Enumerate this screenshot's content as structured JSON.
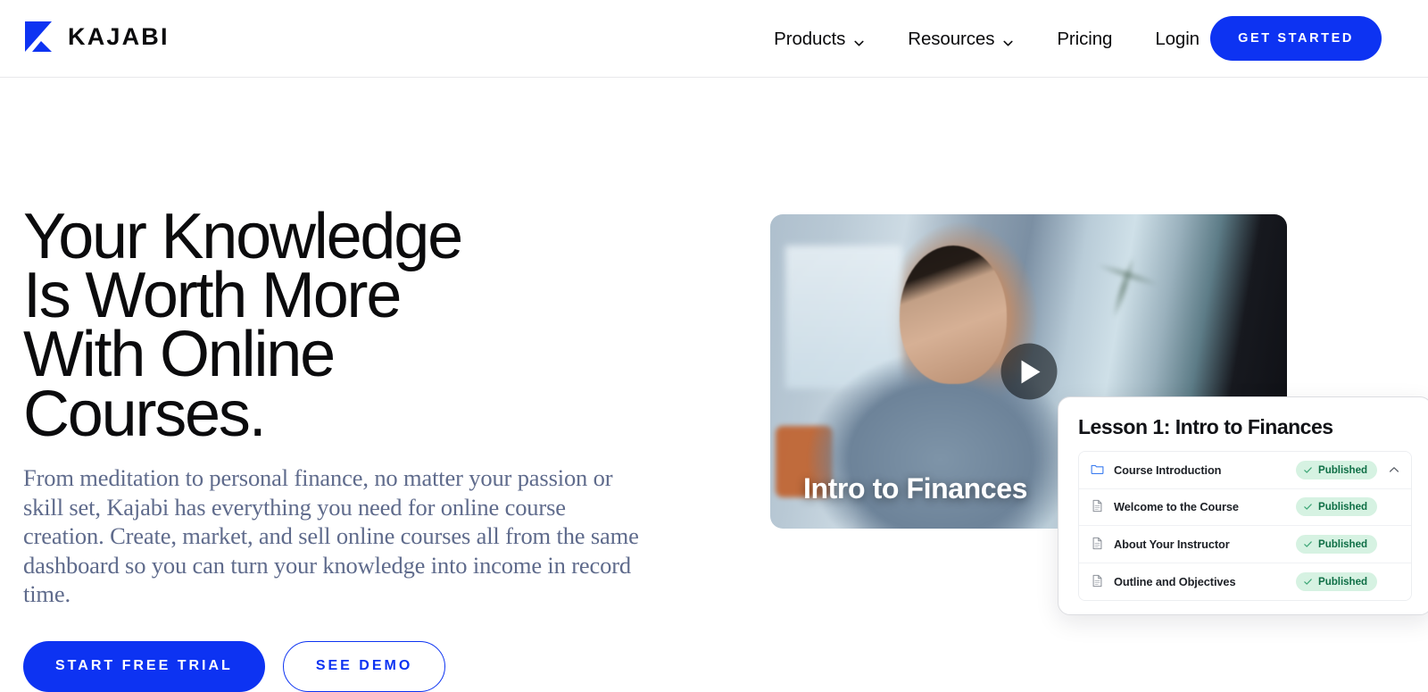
{
  "brand": {
    "name": "KAJABI",
    "logo_icon": "kajabi-k-logo",
    "accent_color": "#0d33f2",
    "text_color": "#0b0b0d"
  },
  "header": {
    "nav": [
      {
        "label": "Products",
        "icon": "chevron-down-icon",
        "has_dropdown": true
      },
      {
        "label": "Resources",
        "icon": "chevron-down-icon",
        "has_dropdown": true
      },
      {
        "label": "Pricing",
        "has_dropdown": false
      },
      {
        "label": "Login",
        "has_dropdown": false
      }
    ],
    "cta": {
      "label": "GET STARTED"
    }
  },
  "hero": {
    "title": "Your Knowledge Is Worth More With Online Courses.",
    "subtitle": "From meditation to personal finance, no matter your passion or skill set, Kajabi has everything you need for online course creation. Create, market, and sell online courses all from the same dashboard so you can turn your knowledge into income in record time.",
    "primary_cta": "START FREE TRIAL",
    "secondary_cta": "SEE DEMO"
  },
  "video": {
    "caption": "Intro to Finances",
    "play_icon": "play-icon"
  },
  "lesson_card": {
    "title": "Lesson 1: Intro to Finances",
    "collapse_icon": "chevron-up-icon",
    "badge_bg": "#d6f2e2",
    "badge_fg": "#0f6f46",
    "rows": [
      {
        "label": "Course Introduction",
        "icon": "folder-icon",
        "status": "Published",
        "status_icon": "check-icon",
        "collapsible": true
      },
      {
        "label": "Welcome to the Course",
        "icon": "document-icon",
        "status": "Published",
        "status_icon": "check-icon",
        "collapsible": false
      },
      {
        "label": "About Your Instructor",
        "icon": "document-icon",
        "status": "Published",
        "status_icon": "check-icon",
        "collapsible": false
      },
      {
        "label": "Outline and Objectives",
        "icon": "document-icon",
        "status": "Published",
        "status_icon": "check-icon",
        "collapsible": false
      }
    ]
  }
}
